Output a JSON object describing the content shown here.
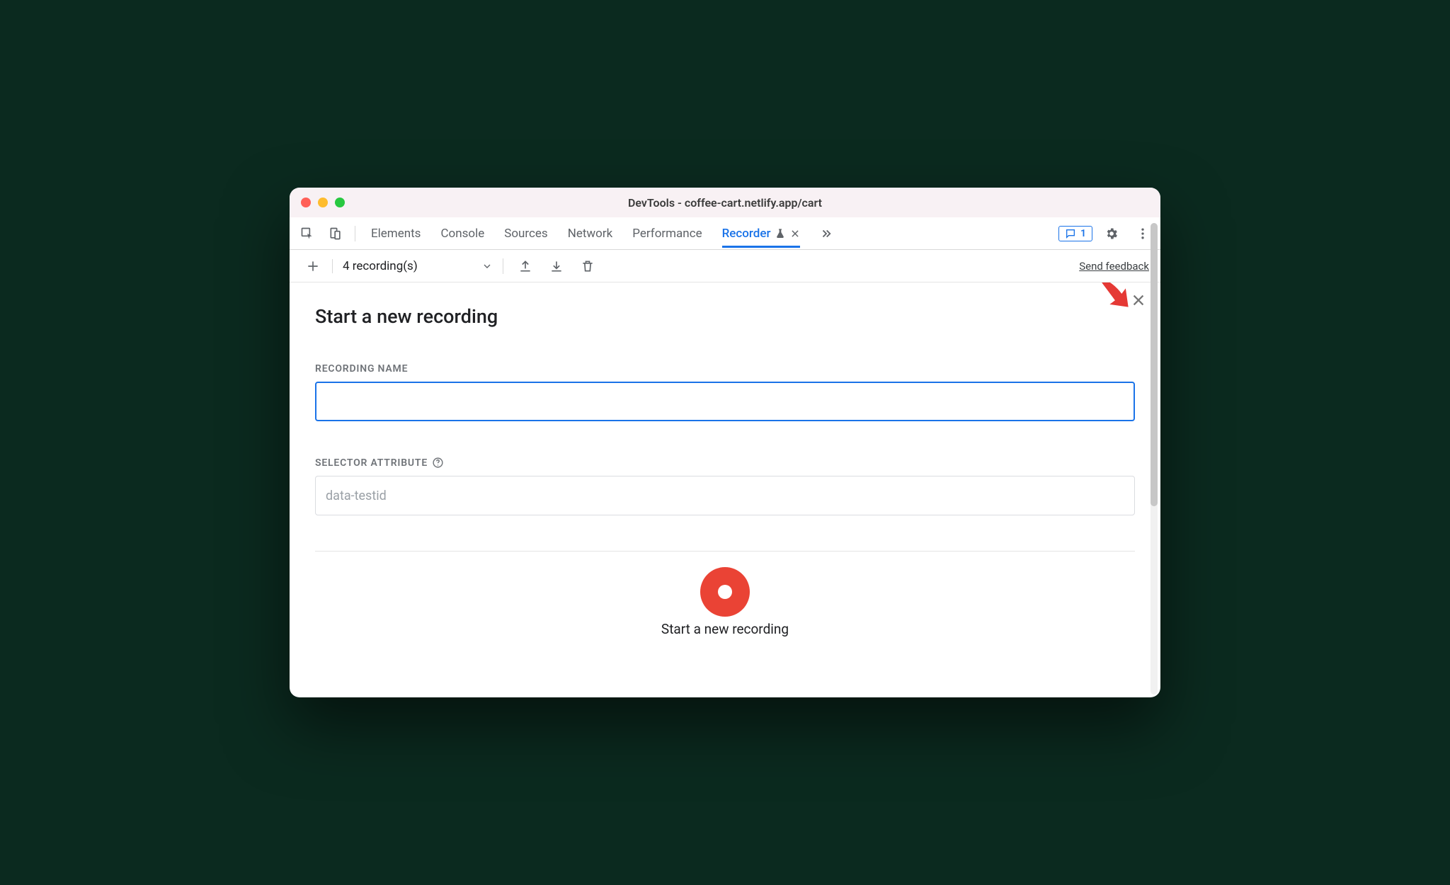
{
  "window": {
    "title": "DevTools - coffee-cart.netlify.app/cart"
  },
  "tabs": {
    "items": [
      "Elements",
      "Console",
      "Sources",
      "Network",
      "Performance",
      "Recorder"
    ],
    "active_index": 5
  },
  "issues_badge": {
    "count": "1"
  },
  "toolbar": {
    "dropdown_label": "4 recording(s)",
    "feedback_label": "Send feedback"
  },
  "panel": {
    "title": "Start a new recording",
    "field_name_label": "RECORDING NAME",
    "field_name_value": "",
    "field_selector_label": "SELECTOR ATTRIBUTE",
    "field_selector_placeholder": "data-testid",
    "field_selector_value": "",
    "record_button_label": "Start a new recording"
  }
}
